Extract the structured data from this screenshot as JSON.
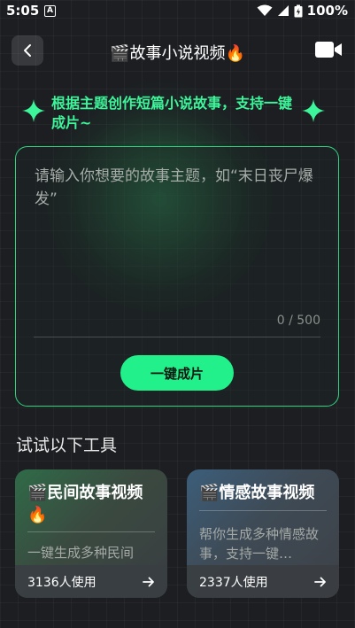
{
  "status_bar": {
    "time": "5:05",
    "notification_glyph": "A",
    "battery": "100%"
  },
  "header": {
    "title": "故事小说视频",
    "title_prefix_emoji": "🎬",
    "title_suffix_emoji": "🔥",
    "back_icon": "chevron-left-icon",
    "right_icon": "video-camera-icon"
  },
  "tagline": "根据主题创作短篇小说故事，支持一键成片~",
  "input": {
    "placeholder": "请输入你想要的故事主题，如“末日丧尸爆发”",
    "counter": "0 / 500",
    "submit_label": "一键成片"
  },
  "tools_section": {
    "title": "试试以下工具",
    "cards": [
      {
        "emoji": "🎬",
        "title": "民间故事视频",
        "title_emoji": "🔥",
        "desc": "一键生成多种民间",
        "usage": "3136人使用"
      },
      {
        "emoji": "🎬",
        "title": "情感故事视频",
        "desc": "帮你生成多种情感故事，支持一键…",
        "usage": "2337人使用"
      }
    ]
  },
  "colors": {
    "accent": "#22f08a",
    "tagline": "#3df59a",
    "background": "#1c1e22"
  }
}
